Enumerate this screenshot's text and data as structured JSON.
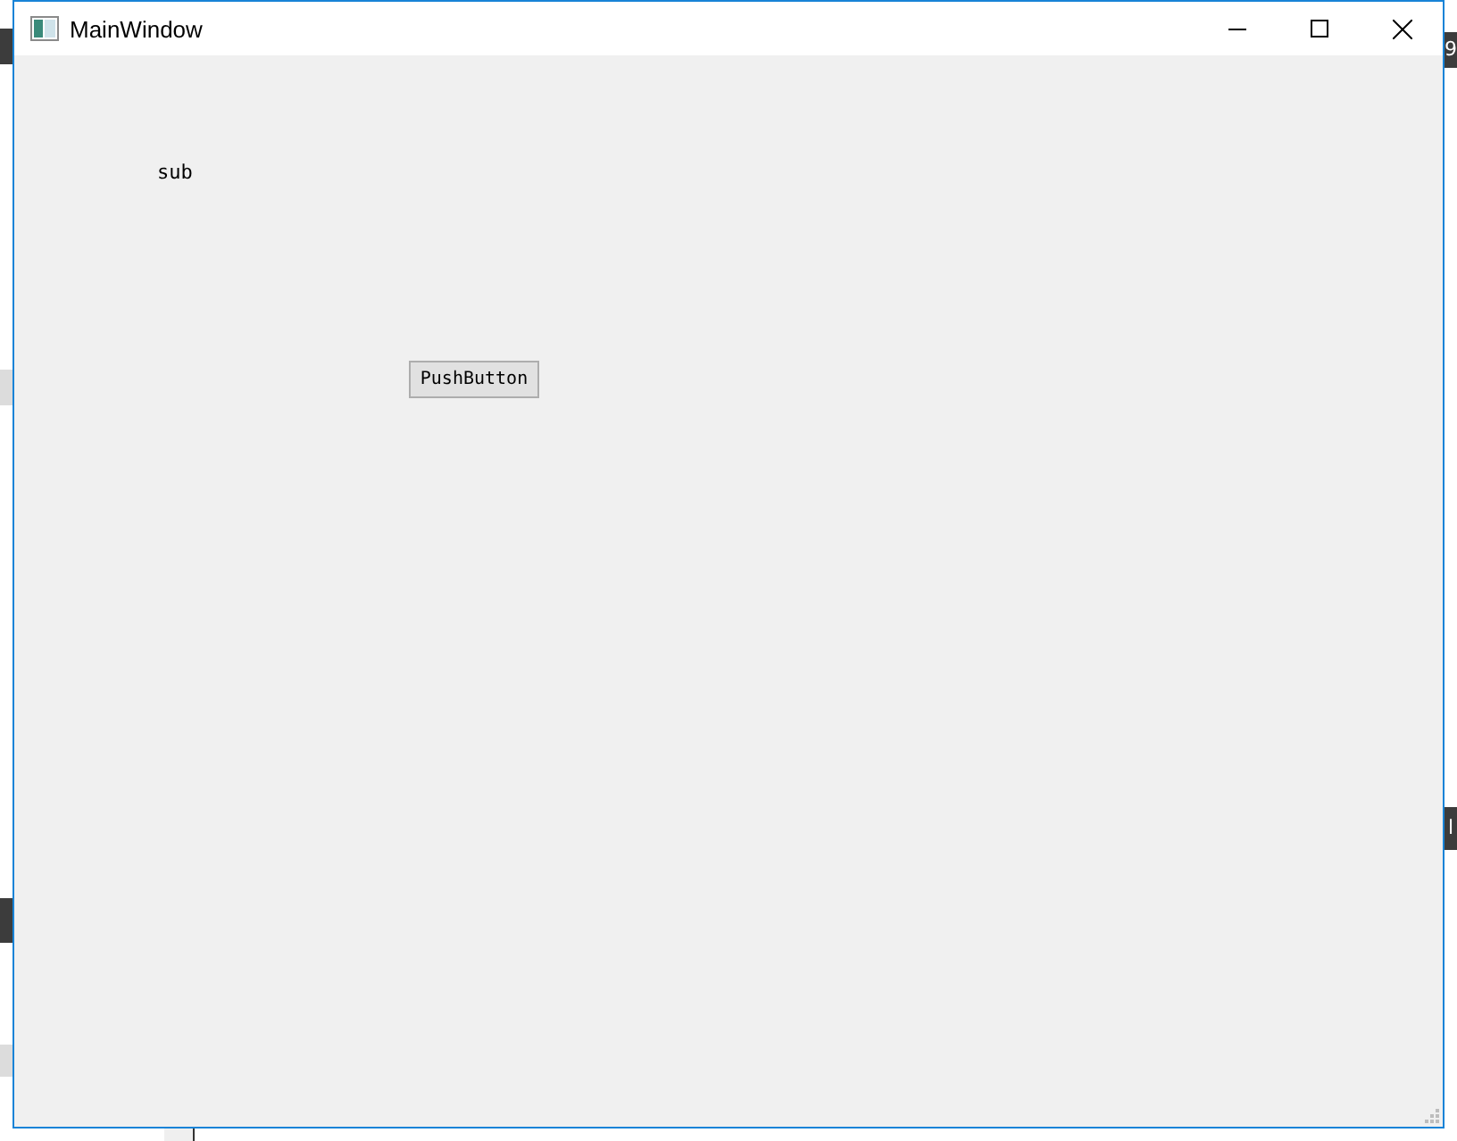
{
  "background": {
    "fragments": [
      "9",
      "l"
    ]
  },
  "window": {
    "title": "MainWindow"
  },
  "labels": [
    {
      "text": "sub"
    }
  ],
  "buttons": [
    {
      "label": "PushButton"
    }
  ]
}
